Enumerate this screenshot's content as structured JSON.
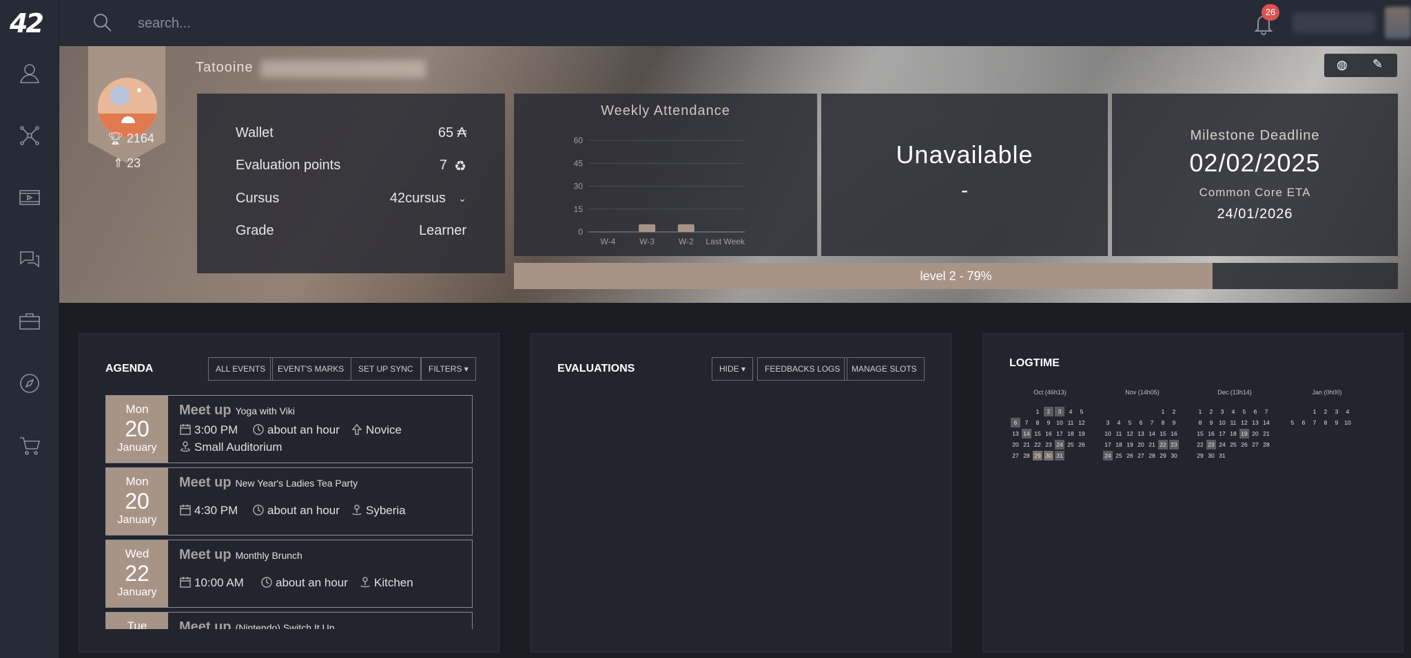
{
  "logo": "42",
  "sidebar": {
    "items": [
      "profile-icon",
      "projects-graph-icon",
      "elearning-icon",
      "forum-icon",
      "companies-icon",
      "compass-icon",
      "shop-icon"
    ]
  },
  "topbar": {
    "search_placeholder": "search...",
    "notifications_count": "26"
  },
  "profile": {
    "campus": "Tatooine",
    "score": "2164",
    "rank": "23",
    "wallet_label": "Wallet",
    "wallet_value": "65 ₳",
    "eval_label": "Evaluation points",
    "eval_value": "7",
    "cursus_label": "Cursus",
    "cursus_value": "42cursus",
    "grade_label": "Grade",
    "grade_value": "Learner"
  },
  "attendance": {
    "title": "Weekly Attendance",
    "status": "Unavailable",
    "status_sub": "-"
  },
  "milestone": {
    "label": "Milestone Deadline",
    "date": "02/02/2025",
    "eta_label": "Common Core ETA",
    "eta_date": "24/01/2026"
  },
  "level": {
    "text": "level 2 - 79%",
    "progress": 0.79
  },
  "chart_data": {
    "type": "bar",
    "title": "Weekly Attendance",
    "categories": [
      "W-4",
      "W-3",
      "W-2",
      "Last Week"
    ],
    "values": [
      0,
      5,
      5,
      0
    ],
    "ylim": [
      0,
      60
    ],
    "yticks": [
      60,
      45,
      30,
      15,
      0
    ],
    "grid": true
  },
  "agenda": {
    "title": "AGENDA",
    "buttons": [
      "ALL EVENTS",
      "EVENT'S MARKS",
      "SET UP SYNC",
      "FILTERS ▾"
    ],
    "events": [
      {
        "dow": "Mon",
        "day": "20",
        "month": "January",
        "kind": "Meet up",
        "name": "Yoga with Viki",
        "time": "3:00 PM",
        "duration": "about an hour",
        "level": "Novice",
        "place": "Small Auditorium"
      },
      {
        "dow": "Mon",
        "day": "20",
        "month": "January",
        "kind": "Meet up",
        "name": "New Year's Ladies Tea Party",
        "time": "4:30 PM",
        "duration": "about an hour",
        "place": "Syberia"
      },
      {
        "dow": "Wed",
        "day": "22",
        "month": "January",
        "kind": "Meet up",
        "name": "Monthly Brunch",
        "time": "10:00 AM",
        "duration": "about an hour",
        "place": "Kitchen"
      },
      {
        "dow": "Tue",
        "kind": "Meet up",
        "name": "(Nintendo) Switch It Up"
      }
    ]
  },
  "evaluations": {
    "title": "EVALUATIONS",
    "buttons": [
      "HIDE ▾",
      "FEEDBACKS LOGS",
      "MANAGE SLOTS"
    ]
  },
  "logtime": {
    "title": "LOGTIME",
    "months": [
      {
        "label": "Oct (46h13)",
        "weeks": [
          [
            "",
            "",
            "1",
            "2",
            "3",
            "4",
            "5"
          ],
          [
            "6",
            "7",
            "8",
            "9",
            "10",
            "11",
            "12"
          ],
          [
            "13",
            "14",
            "15",
            "16",
            "17",
            "18",
            "19"
          ],
          [
            "20",
            "21",
            "22",
            "23",
            "24",
            "25",
            "26"
          ],
          [
            "27",
            "28",
            "29",
            "30",
            "31",
            "",
            ""
          ]
        ],
        "on": [
          "2",
          "3",
          "6",
          "14",
          "24",
          "29",
          "30",
          "31"
        ],
        "hi": [
          "29",
          "30"
        ]
      },
      {
        "label": "Nov (14h05)",
        "weeks": [
          [
            "",
            "",
            "",
            "",
            "",
            "1",
            "2"
          ],
          [
            "3",
            "4",
            "5",
            "6",
            "7",
            "8",
            "9"
          ],
          [
            "10",
            "11",
            "12",
            "13",
            "14",
            "15",
            "16"
          ],
          [
            "17",
            "18",
            "19",
            "20",
            "21",
            "22",
            "23"
          ],
          [
            "24",
            "25",
            "26",
            "27",
            "28",
            "29",
            "30"
          ]
        ],
        "on": [
          "22",
          "23",
          "24"
        ],
        "hi": []
      },
      {
        "label": "Dec (13h14)",
        "weeks": [
          [
            "1",
            "2",
            "3",
            "4",
            "5",
            "6",
            "7"
          ],
          [
            "8",
            "9",
            "10",
            "11",
            "12",
            "13",
            "14"
          ],
          [
            "15",
            "16",
            "17",
            "18",
            "19",
            "20",
            "21"
          ],
          [
            "22",
            "23",
            "24",
            "25",
            "26",
            "27",
            "28"
          ],
          [
            "29",
            "30",
            "31",
            "",
            "",
            "",
            ""
          ]
        ],
        "on": [
          "19",
          "23"
        ],
        "hi": []
      },
      {
        "label": "Jan (0h00)",
        "weeks": [
          [
            "",
            "",
            "1",
            "2",
            "3",
            "4",
            ""
          ],
          [
            "5",
            "6",
            "7",
            "8",
            "9",
            "10",
            ""
          ]
        ],
        "on": [],
        "hi": []
      }
    ]
  },
  "colors": {
    "accent": "#a89387",
    "badge": "#d9534f",
    "panel": "#22252d",
    "sidebar": "#272b35"
  }
}
